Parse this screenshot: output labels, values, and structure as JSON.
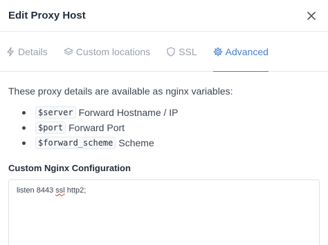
{
  "modal": {
    "title": "Edit Proxy Host"
  },
  "tabs": [
    {
      "label": "Details",
      "icon": "bolt-icon",
      "active": false
    },
    {
      "label": "Custom locations",
      "icon": "layers-icon",
      "active": false
    },
    {
      "label": "SSL",
      "icon": "shield-icon",
      "active": false
    },
    {
      "label": "Advanced",
      "icon": "gear-icon",
      "active": true
    }
  ],
  "advanced": {
    "intro": "These proxy details are available as nginx variables:",
    "variables": [
      {
        "code": "$server",
        "desc": "Forward Hostname / IP"
      },
      {
        "code": "$port",
        "desc": "Forward Port"
      },
      {
        "code": "$forward_scheme",
        "desc": "Scheme"
      }
    ],
    "config_label": "Custom Nginx Configuration",
    "config_value_before": "listen 8443 ",
    "config_value_spell": "ssl",
    "config_value_after": " http2;"
  },
  "colors": {
    "accent": "#467fcf",
    "muted": "#9aa0ac",
    "text": "#232e3c"
  }
}
